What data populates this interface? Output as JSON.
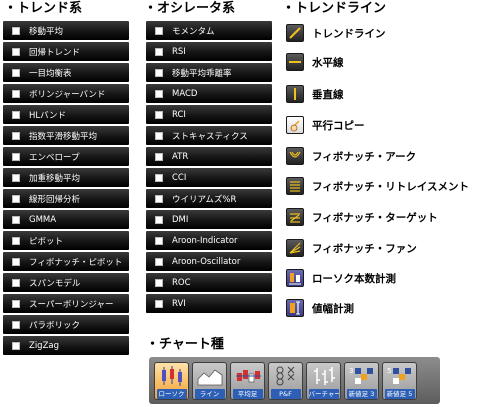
{
  "trend": {
    "title": "・トレンド系",
    "items": [
      "移動平均",
      "回帰トレンド",
      "一目均衡表",
      "ボリンジャーバンド",
      "HLバンド",
      "指数平滑移動平均",
      "エンベロープ",
      "加重移動平均",
      "線形回帰分析",
      "GMMA",
      "ピボット",
      "フィボナッチ・ピボット",
      "スパンモデル",
      "スーパーボリンジャー",
      "パラボリック",
      "ZigZag"
    ]
  },
  "oscillator": {
    "title": "・オシレータ系",
    "items": [
      "モメンタム",
      "RSI",
      "移動平均乖離率",
      "MACD",
      "RCI",
      "ストキャスティクス",
      "ATR",
      "CCI",
      "ウイリアムズ%R",
      "DMI",
      "Aroon-Indicator",
      "Aroon-Oscillator",
      "ROC",
      "RVI"
    ]
  },
  "trendline": {
    "title": "・トレンドライン",
    "tools": [
      {
        "label": "トレンドライン",
        "icon": "diagonal-line-icon"
      },
      {
        "label": "水平線",
        "icon": "horizontal-line-icon"
      },
      {
        "label": "垂直線",
        "icon": "vertical-line-icon"
      },
      {
        "label": "平行コピー",
        "icon": "hand-copy-icon"
      },
      {
        "label": "フィボナッチ・アーク",
        "icon": "fibonacci-arc-icon"
      },
      {
        "label": "フィボナッチ・リトレイスメント",
        "icon": "fibonacci-retracement-icon"
      },
      {
        "label": "フィボナッチ・ターゲット",
        "icon": "fibonacci-target-icon"
      },
      {
        "label": "フィボナッチ・ファン",
        "icon": "fibonacci-fan-icon"
      },
      {
        "label": "ローソク本数計測",
        "icon": "candle-count-icon"
      },
      {
        "label": "値幅計測",
        "icon": "price-range-icon"
      }
    ]
  },
  "chart_types": {
    "title": "・チャート種",
    "buttons": [
      {
        "label": "ローソク",
        "icon": "candlestick-icon",
        "active": true
      },
      {
        "label": "ライン",
        "icon": "line-chart-icon"
      },
      {
        "label": "平均足",
        "icon": "heikin-ashi-icon"
      },
      {
        "label": "P&F",
        "icon": "point-and-figure-icon"
      },
      {
        "label": "バーチャート",
        "icon": "bar-chart-icon"
      },
      {
        "label": "新値足 3",
        "icon": "new-price-3-icon"
      },
      {
        "label": "新値足 5",
        "icon": "new-price-5-icon"
      }
    ]
  },
  "colors": {
    "accent": "#f2a232",
    "list_bg": "#151515",
    "label_blue": "#2c5fb5",
    "icon_gold": "#f0c020"
  }
}
